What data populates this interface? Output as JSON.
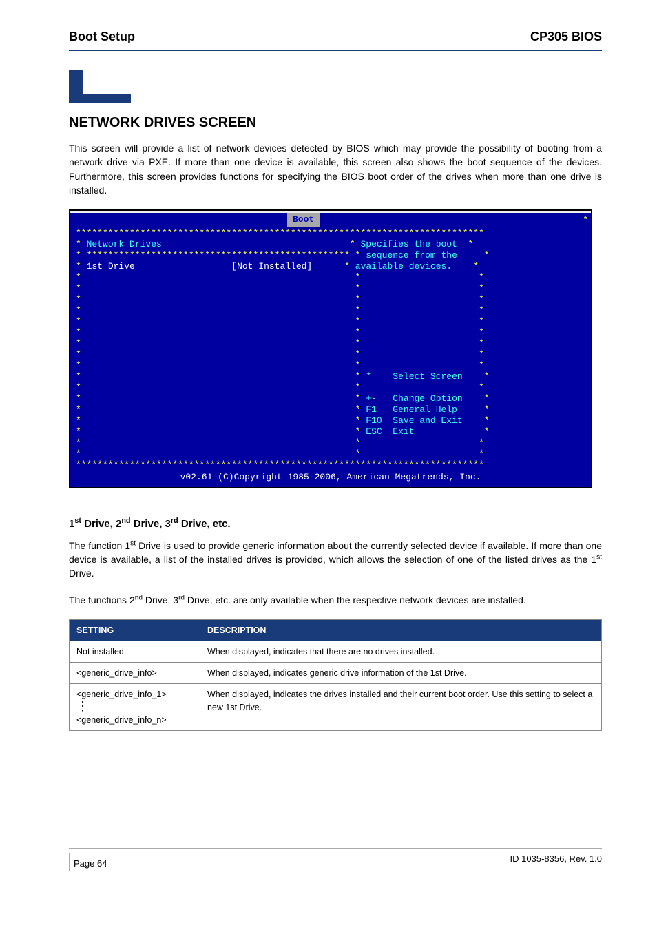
{
  "header": {
    "left": "Boot Setup",
    "right": "CP305 BIOS"
  },
  "section_title": "NETWORK DRIVES SCREEN",
  "section_body": "This screen will provide a list of network devices detected by BIOS which may provide the possibility of booting from a network drive via PXE. If more than one device is available, this screen also shows the boot sequence of the devices. Furthermore, this screen provides functions for specifying the BIOS boot order of the drives when more than one drive is installed.",
  "bios": {
    "tab": "Boot",
    "group_label": "Network Drives",
    "item_label": "1st Drive",
    "item_value": "[Not Installed]",
    "help1": "Specifies the boot",
    "help2": "sequence from the",
    "help3": "available devices.",
    "nav_select": "Select Screen",
    "nav_change_key": "+-",
    "nav_change": "Change Option",
    "nav_f1_key": "F1",
    "nav_f1": "General Help",
    "nav_f10_key": "F10",
    "nav_f10": "Save and Exit",
    "nav_esc_key": "ESC",
    "nav_esc": "Exit",
    "footer": "v02.61 (C)Copyright 1985-2006, American Megatrends, Inc."
  },
  "sub_heading_prefix": "1",
  "sub_heading_mid1": " Drive, 2",
  "sub_heading_mid2": " Drive, 3",
  "sub_heading_suffix": " Drive, etc.",
  "sup_st": "st",
  "sup_nd": "nd",
  "sup_rd": "rd",
  "drive_p1a": "The function 1",
  "drive_p1b": " Drive is used to provide generic information about the currently selected device if available. If more than one device is available, a list of the installed drives is provided, which allows the selection of one of the listed drives as the 1",
  "drive_p1c": " Drive.",
  "drive_p2a": "The functions 2",
  "drive_p2b": " Drive, 3",
  "drive_p2c": " Drive, etc. are only available when the respective network devices are installed.",
  "table": {
    "h1": "SETTING",
    "h2": "DESCRIPTION",
    "r1c1": "Not installed",
    "r1c2": "When displayed, indicates that there are no drives installed.",
    "r2c1": "<generic_drive_info>",
    "r2c2": "When displayed, indicates generic drive information of the 1st Drive.",
    "r3c1a": "<generic_drive_info_1>",
    "r3c1b": "<generic_drive_info_n>",
    "r3c2": "When displayed, indicates the drives installed and their current boot order. Use this setting to select a new 1st Drive."
  },
  "footer": {
    "left": "Page 64",
    "right": "ID 1035-8356, Rev. 1.0"
  }
}
